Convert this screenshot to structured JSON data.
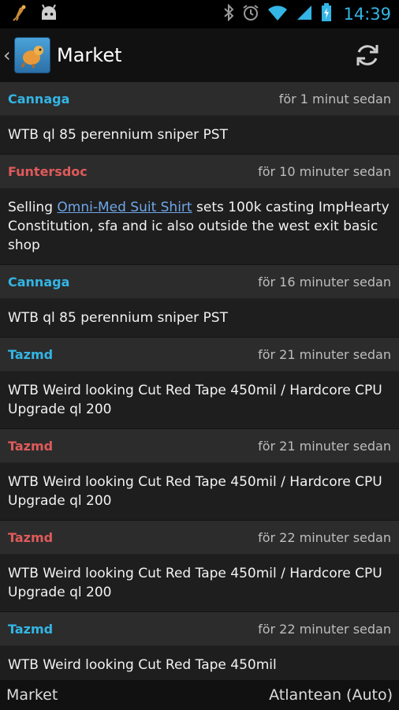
{
  "status_bar": {
    "time": "14:39",
    "icons": [
      "bug-icon",
      "android-icon",
      "bluetooth-icon",
      "alarm-icon",
      "wifi-icon",
      "signal-icon",
      "battery-icon"
    ],
    "accent": "#33b5e5"
  },
  "action_bar": {
    "title": "Market",
    "icons": [
      "up-caret-icon",
      "app-logo-icon",
      "refresh-icon"
    ]
  },
  "messages": [
    {
      "author": "Cannaga",
      "author_color": "#33b5e5",
      "time": "för 1 minut sedan",
      "pre": "WTB ql 85 perennium sniper PST",
      "link": "",
      "post": ""
    },
    {
      "author": "Funtersdoc",
      "author_color": "#e05a5a",
      "time": "för 10 minuter sedan",
      "pre": "Selling ",
      "link": "Omni-Med Suit Shirt",
      "post": " sets 100k casting ImpHearty Constitution, sfa and ic also outside the west exit basic shop"
    },
    {
      "author": "Cannaga",
      "author_color": "#33b5e5",
      "time": "för 16 minuter sedan",
      "pre": "WTB ql 85 perennium sniper PST",
      "link": "",
      "post": ""
    },
    {
      "author": "Tazmd",
      "author_color": "#33b5e5",
      "time": "för 21 minuter sedan",
      "pre": "WTB Weird looking Cut Red Tape 450mil / Hardcore CPU Upgrade ql 200",
      "link": "",
      "post": ""
    },
    {
      "author": "Tazmd",
      "author_color": "#e05a5a",
      "time": "för 21 minuter sedan",
      "pre": "WTB Weird looking Cut Red Tape 450mil / Hardcore CPU Upgrade ql 200",
      "link": "",
      "post": ""
    },
    {
      "author": "Tazmd",
      "author_color": "#e05a5a",
      "time": "för 22 minuter sedan",
      "pre": "WTB Weird looking Cut Red Tape 450mil / Hardcore CPU Upgrade ql 200",
      "link": "",
      "post": ""
    },
    {
      "author": "Tazmd",
      "author_color": "#33b5e5",
      "time": "för 22 minuter sedan",
      "pre": "WTB Weird looking Cut Red Tape 450mil",
      "link": "",
      "post": ""
    }
  ],
  "bottom_bar": {
    "left": "Market",
    "right": "Atlantean (Auto)"
  }
}
